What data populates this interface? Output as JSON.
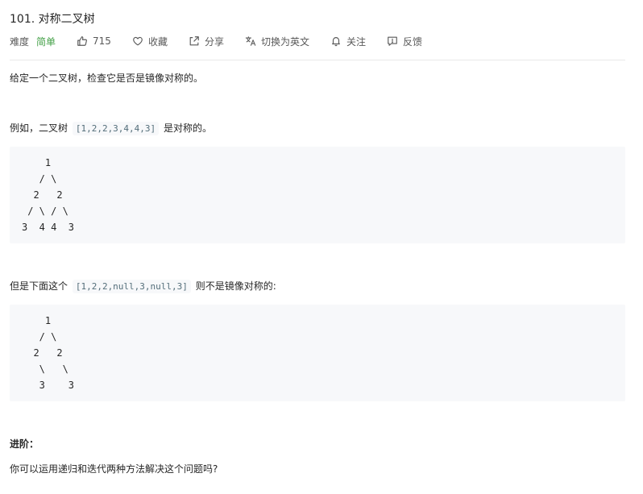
{
  "problem": {
    "title": "101. 对称二叉树"
  },
  "meta": {
    "difficulty_label": "难度",
    "difficulty_value": "简单",
    "likes_count": "715",
    "favorite_label": "收藏",
    "share_label": "分享",
    "translate_label": "切换为英文",
    "follow_label": "关注",
    "feedback_label": "反馈"
  },
  "description": {
    "intro": "给定一个二叉树，检查它是否是镜像对称的。",
    "example1_prefix": "例如，二叉树 ",
    "example1_code": "[1,2,2,3,4,4,3]",
    "example1_suffix": " 是对称的。",
    "tree1": "    1\n   / \\\n  2   2\n / \\ / \\\n3  4 4  3",
    "example2_prefix": "但是下面这个 ",
    "example2_code": "[1,2,2,null,3,null,3]",
    "example2_suffix": " 则不是镜像对称的:",
    "tree2": "    1\n   / \\\n  2   2\n   \\   \\\n   3    3",
    "advanced_title": "进阶：",
    "advanced_text": "你可以运用递归和迭代两种方法解决这个问题吗?"
  },
  "colors": {
    "difficulty_easy": "#43a047",
    "text": "#262626",
    "meta_text": "#595959",
    "code_bg": "#f7f8fa"
  },
  "icons": {
    "like": "thumbs-up-icon",
    "favorite": "heart-icon",
    "share": "share-icon",
    "translate": "translate-icon",
    "follow": "bell-icon",
    "feedback": "feedback-icon"
  }
}
